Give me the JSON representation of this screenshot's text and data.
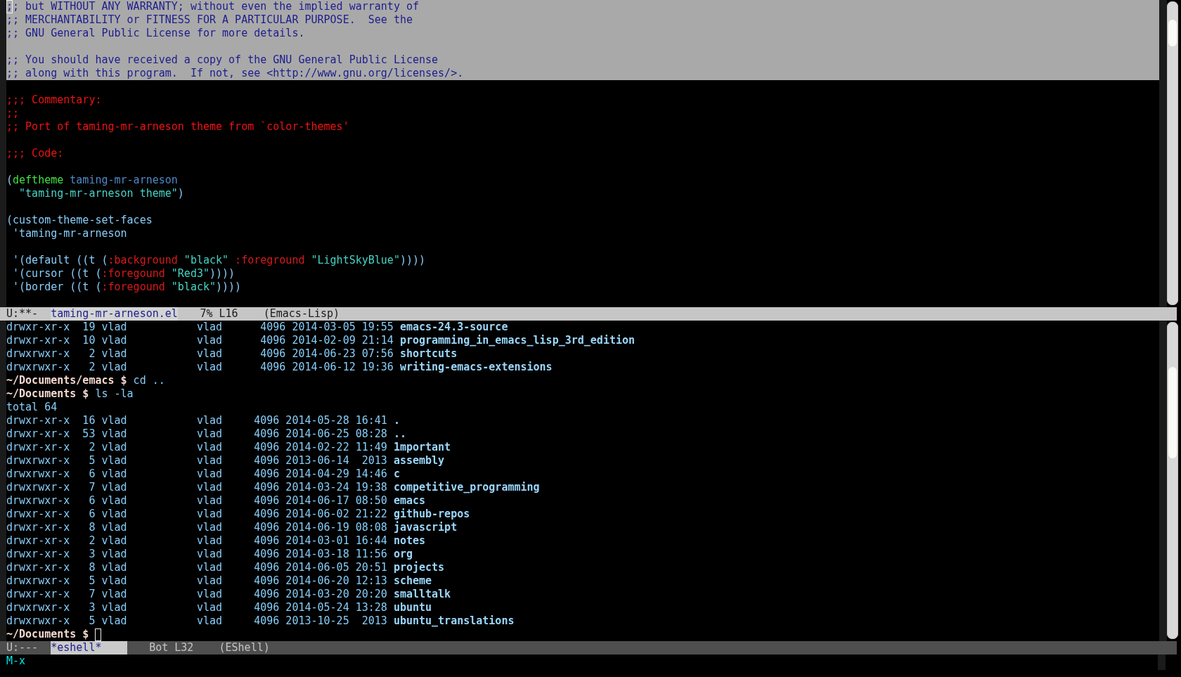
{
  "top_window": {
    "lines": [
      {
        "kind": "code",
        "in_region": true,
        "segments": [
          {
            "text": ";",
            "kind": "cursor"
          },
          {
            "text": "; but WITHOUT ANY WARRANTY; without even the implied warranty of",
            "kind": "comment"
          }
        ]
      },
      {
        "kind": "code",
        "in_region": true,
        "segments": [
          {
            "text": ";; MERCHANTABILITY or FITNESS FOR A PARTICULAR PURPOSE.  See the",
            "kind": "comment"
          }
        ]
      },
      {
        "kind": "code",
        "in_region": true,
        "segments": [
          {
            "text": ";; GNU General Public License for more details.",
            "kind": "comment"
          }
        ]
      },
      {
        "kind": "blank",
        "in_region": true
      },
      {
        "kind": "code",
        "in_region": true,
        "segments": [
          {
            "text": ";; You should have received a copy of the GNU General Public License",
            "kind": "comment"
          }
        ]
      },
      {
        "kind": "code",
        "in_region": true,
        "segments": [
          {
            "text": ";; along with this program.  If not, see <http://www.gnu.org/licenses/>.",
            "kind": "comment"
          }
        ]
      },
      {
        "kind": "blank",
        "in_region": false
      },
      {
        "kind": "code",
        "in_region": false,
        "segments": [
          {
            "text": ";;; Commentary:",
            "kind": "comment"
          }
        ]
      },
      {
        "kind": "code",
        "in_region": false,
        "segments": [
          {
            "text": ";;",
            "kind": "comment"
          }
        ]
      },
      {
        "kind": "code",
        "in_region": false,
        "segments": [
          {
            "text": ";; Port of taming-mr-arneson theme from `color-themes'",
            "kind": "comment"
          }
        ]
      },
      {
        "kind": "blank",
        "in_region": false
      },
      {
        "kind": "code",
        "in_region": false,
        "segments": [
          {
            "text": ";;; Code:",
            "kind": "comment"
          }
        ]
      },
      {
        "kind": "blank",
        "in_region": false
      },
      {
        "kind": "code",
        "in_region": false,
        "segments": [
          {
            "text": "(",
            "kind": "default"
          },
          {
            "text": "deftheme",
            "kind": "keyword"
          },
          {
            "text": " taming-mr-arneson",
            "kind": "name"
          }
        ]
      },
      {
        "kind": "code",
        "in_region": false,
        "segments": [
          {
            "text": "  \"taming-mr-arneson theme\"",
            "kind": "string"
          },
          {
            "text": ")",
            "kind": "default"
          }
        ]
      },
      {
        "kind": "blank",
        "in_region": false
      },
      {
        "kind": "code",
        "in_region": false,
        "segments": [
          {
            "text": "(custom-theme-set-faces",
            "kind": "default"
          }
        ]
      },
      {
        "kind": "code",
        "in_region": false,
        "segments": [
          {
            "text": " 'taming-mr-arneson",
            "kind": "default"
          }
        ]
      },
      {
        "kind": "blank",
        "in_region": false
      },
      {
        "kind": "code",
        "in_region": false,
        "segments": [
          {
            "text": " '(default ((t (",
            "kind": "default"
          },
          {
            "text": ":background",
            "kind": "builtin"
          },
          {
            "text": " \"black\"",
            "kind": "string"
          },
          {
            "text": " :foreground",
            "kind": "builtin"
          },
          {
            "text": " \"LightSkyBlue\"",
            "kind": "string"
          },
          {
            "text": "))))",
            "kind": "default"
          }
        ]
      },
      {
        "kind": "code",
        "in_region": false,
        "segments": [
          {
            "text": " '(cursor ((t (",
            "kind": "default"
          },
          {
            "text": ":foregound",
            "kind": "builtin"
          },
          {
            "text": " \"Red3\"",
            "kind": "string"
          },
          {
            "text": "))))",
            "kind": "default"
          }
        ]
      },
      {
        "kind": "code",
        "in_region": false,
        "segments": [
          {
            "text": " '(border ((t (",
            "kind": "default"
          },
          {
            "text": ":foregound",
            "kind": "builtin"
          },
          {
            "text": " \"black\"",
            "kind": "string"
          },
          {
            "text": "))))",
            "kind": "default"
          }
        ]
      },
      {
        "kind": "blank",
        "in_region": false
      }
    ],
    "mode_line": {
      "active": true,
      "status": "U:**-",
      "buffer_name": "taming-mr-arneson.el",
      "position": "7% L16",
      "mode": "(Emacs-Lisp)"
    }
  },
  "bottom_window": {
    "lines": [
      {
        "kind": "code",
        "in_region": false,
        "segments": [
          {
            "text": "drwxr-xr-x  19 vlad           vlad      4096 2014-03-05 19:55",
            "kind": "listing"
          },
          {
            "text": "emacs-24.3-source",
            "kind": "dir"
          }
        ]
      },
      {
        "kind": "code",
        "in_region": false,
        "segments": [
          {
            "text": "drwxr-xr-x  10 vlad           vlad      4096 2014-02-09 21:14",
            "kind": "listing"
          },
          {
            "text": "programming_in_emacs_lisp_3rd_edition",
            "kind": "dir"
          }
        ]
      },
      {
        "kind": "code",
        "in_region": false,
        "segments": [
          {
            "text": "drwxrwxr-x   2 vlad           vlad      4096 2014-06-23 07:56",
            "kind": "listing"
          },
          {
            "text": "shortcuts",
            "kind": "dir"
          }
        ]
      },
      {
        "kind": "code",
        "in_region": false,
        "segments": [
          {
            "text": "drwxrwxr-x   2 vlad           vlad      4096 2014-06-12 19:36",
            "kind": "listing"
          },
          {
            "text": "writing-emacs-extensions",
            "kind": "dir"
          }
        ]
      },
      {
        "kind": "code",
        "in_region": false,
        "segments": [
          {
            "text": "~/Documents/emacs $",
            "kind": "prompt"
          },
          {
            "text": "cd ..",
            "kind": "command"
          }
        ]
      },
      {
        "kind": "code",
        "in_region": false,
        "segments": [
          {
            "text": "~/Documents $",
            "kind": "prompt"
          },
          {
            "text": "ls -la",
            "kind": "command"
          }
        ]
      },
      {
        "kind": "code",
        "in_region": false,
        "segments": [
          {
            "text": "total 64",
            "kind": "listing"
          }
        ]
      },
      {
        "kind": "code",
        "in_region": false,
        "segments": [
          {
            "text": "drwxr-xr-x  16 vlad           vlad     4096 2014-05-28 16:41",
            "kind": "listing"
          },
          {
            "text": ".",
            "kind": "dir"
          }
        ]
      },
      {
        "kind": "code",
        "in_region": false,
        "segments": [
          {
            "text": "drwxr-xr-x  53 vlad           vlad     4096 2014-06-25 08:28",
            "kind": "listing"
          },
          {
            "text": "..",
            "kind": "dir"
          }
        ]
      },
      {
        "kind": "code",
        "in_region": false,
        "segments": [
          {
            "text": "drwxr-xr-x   2 vlad           vlad     4096 2014-02-22 11:49",
            "kind": "listing"
          },
          {
            "text": "1mportant",
            "kind": "dir"
          }
        ]
      },
      {
        "kind": "code",
        "in_region": false,
        "segments": [
          {
            "text": "drwxrwxr-x   5 vlad           vlad     4096 2013-06-14  2013",
            "kind": "listing"
          },
          {
            "text": "assembly",
            "kind": "dir"
          }
        ]
      },
      {
        "kind": "code",
        "in_region": false,
        "segments": [
          {
            "text": "drwxrwxr-x   6 vlad           vlad     4096 2014-04-29 14:46",
            "kind": "listing"
          },
          {
            "text": "c",
            "kind": "dir"
          }
        ]
      },
      {
        "kind": "code",
        "in_region": false,
        "segments": [
          {
            "text": "drwxrwxr-x   7 vlad           vlad     4096 2014-03-24 19:38",
            "kind": "listing"
          },
          {
            "text": "competitive_programming",
            "kind": "dir"
          }
        ]
      },
      {
        "kind": "code",
        "in_region": false,
        "segments": [
          {
            "text": "drwxrwxr-x   6 vlad           vlad     4096 2014-06-17 08:50",
            "kind": "listing"
          },
          {
            "text": "emacs",
            "kind": "dir"
          }
        ]
      },
      {
        "kind": "code",
        "in_region": false,
        "segments": [
          {
            "text": "drwxr-xr-x   6 vlad           vlad     4096 2014-06-02 21:22",
            "kind": "listing"
          },
          {
            "text": "github-repos",
            "kind": "dir"
          }
        ]
      },
      {
        "kind": "code",
        "in_region": false,
        "segments": [
          {
            "text": "drwxr-xr-x   8 vlad           vlad     4096 2014-06-19 08:08",
            "kind": "listing"
          },
          {
            "text": "javascript",
            "kind": "dir"
          }
        ]
      },
      {
        "kind": "code",
        "in_region": false,
        "segments": [
          {
            "text": "drwxr-xr-x   2 vlad           vlad     4096 2014-03-01 16:44",
            "kind": "listing"
          },
          {
            "text": "notes",
            "kind": "dir"
          }
        ]
      },
      {
        "kind": "code",
        "in_region": false,
        "segments": [
          {
            "text": "drwxr-xr-x   3 vlad           vlad     4096 2014-03-18 11:56",
            "kind": "listing"
          },
          {
            "text": "org",
            "kind": "dir"
          }
        ]
      },
      {
        "kind": "code",
        "in_region": false,
        "segments": [
          {
            "text": "drwxr-xr-x   8 vlad           vlad     4096 2014-06-05 20:51",
            "kind": "listing"
          },
          {
            "text": "projects",
            "kind": "dir"
          }
        ]
      },
      {
        "kind": "code",
        "in_region": false,
        "segments": [
          {
            "text": "drwxrwxr-x   5 vlad           vlad     4096 2014-06-20 12:13",
            "kind": "listing"
          },
          {
            "text": "scheme",
            "kind": "dir"
          }
        ]
      },
      {
        "kind": "code",
        "in_region": false,
        "segments": [
          {
            "text": "drwxr-xr-x   7 vlad           vlad     4096 2014-03-20 20:20",
            "kind": "listing"
          },
          {
            "text": "smalltalk",
            "kind": "dir"
          }
        ]
      },
      {
        "kind": "code",
        "in_region": false,
        "segments": [
          {
            "text": "drwxrwxr-x   3 vlad           vlad     4096 2014-05-24 13:28",
            "kind": "listing"
          },
          {
            "text": "ubuntu",
            "kind": "dir"
          }
        ]
      },
      {
        "kind": "code",
        "in_region": false,
        "segments": [
          {
            "text": "drwxrwxr-x   5 vlad           vlad     4096 2013-10-25  2013",
            "kind": "listing"
          },
          {
            "text": "ubuntu_translations",
            "kind": "dir"
          }
        ]
      },
      {
        "kind": "code",
        "in_region": false,
        "segments": [
          {
            "text": "~/Documents $",
            "kind": "prompt"
          }
        ]
      }
    ],
    "cursor": true,
    "mode_line": {
      "active": false,
      "status": "U:---",
      "buffer_name": "*eshell*",
      "position": "Bot L32",
      "mode": "(EShell)"
    }
  },
  "minibuffer": {
    "text": "M-x"
  }
}
